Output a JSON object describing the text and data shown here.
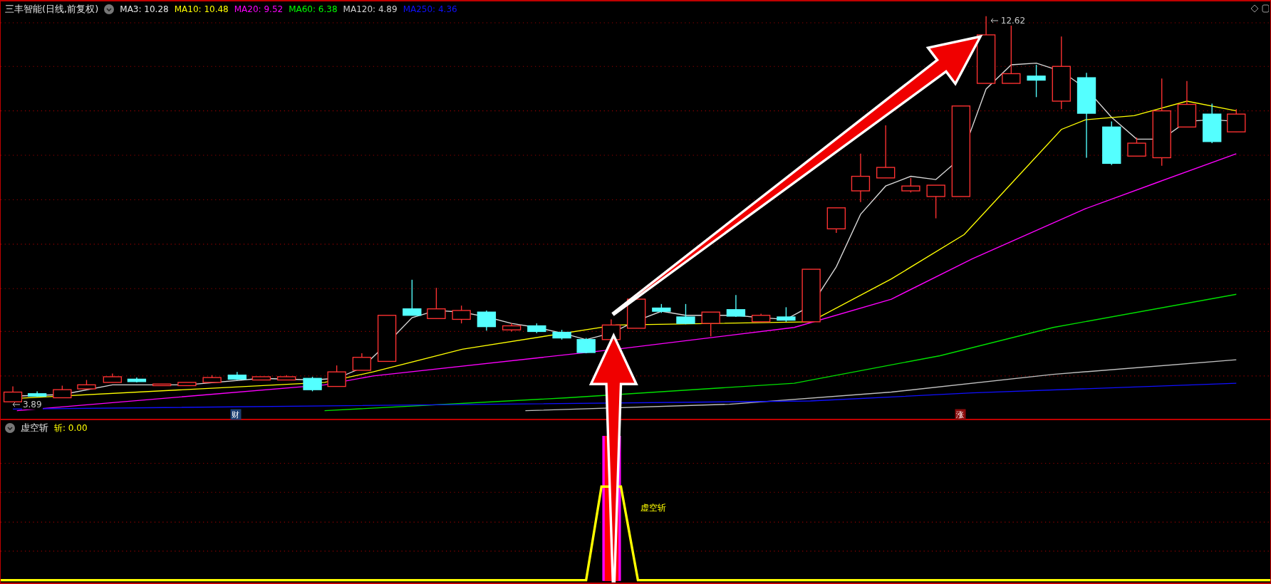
{
  "main_panel": {
    "title": "三丰智能(日线,前复权)",
    "indicators": [
      {
        "label": "MA3: 10.28",
        "color": "#e8e8e8"
      },
      {
        "label": "MA10: 10.48",
        "color": "#ffff00"
      },
      {
        "label": "MA20: 9.52",
        "color": "#ff00ff"
      },
      {
        "label": "MA60: 6.38",
        "color": "#00ff00"
      },
      {
        "label": "MA120: 4.89",
        "color": "#d0d0d0"
      },
      {
        "label": "MA250: 4.36",
        "color": "#1010ff"
      }
    ],
    "price_labels": [
      {
        "text": "12.62"
      },
      {
        "text": "3.89"
      }
    ],
    "event_markers": [
      {
        "text": "财",
        "color": "#1c3f72"
      },
      {
        "text": "涨",
        "color": "#8a0a0a"
      }
    ]
  },
  "sub_panel": {
    "title": "虚空斩",
    "indicators": [
      {
        "label": "斩: 0.00",
        "color": "#ffff00"
      }
    ],
    "signal_label": "虚空斩"
  }
}
